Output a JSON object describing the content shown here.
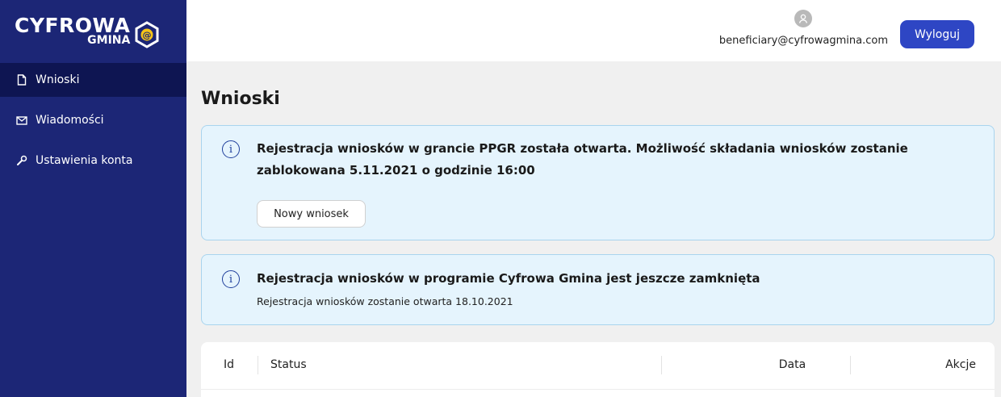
{
  "brand": {
    "line1": "CYFROWA",
    "line2": "GMINA",
    "symbol": "@"
  },
  "sidebar": {
    "items": [
      {
        "label": "Wnioski",
        "icon": "document-icon",
        "active": true
      },
      {
        "label": "Wiadomości",
        "icon": "mail-icon",
        "active": false
      },
      {
        "label": "Ustawienia konta",
        "icon": "wrench-icon",
        "active": false
      }
    ]
  },
  "header": {
    "user_email": "beneficiary@cyfrowagmina.com",
    "logout_label": "Wyloguj"
  },
  "main": {
    "title": "Wnioski",
    "alerts": [
      {
        "title": "Rejestracja wniosków w grancie PPGR została otwarta. Możliwość składania wniosków zostanie zablokowana 5.11.2021 o godzinie 16:00",
        "button_label": "Nowy wniosek"
      },
      {
        "title": "Rejestracja wniosków w programie Cyfrowa Gmina jest jeszcze zamknięta",
        "subtitle": "Rejestracja wniosków zostanie otwarta 18.10.2021"
      }
    ],
    "table": {
      "columns": [
        "Id",
        "Status",
        "Data",
        "Akcje"
      ]
    }
  },
  "colors": {
    "sidebar_bg": "#1c2676",
    "sidebar_active": "#0e1552",
    "primary_button": "#2e46c4",
    "alert_bg": "#e5f4fd",
    "alert_border": "#a9d4ee",
    "logo_accent": "#f5c518"
  }
}
